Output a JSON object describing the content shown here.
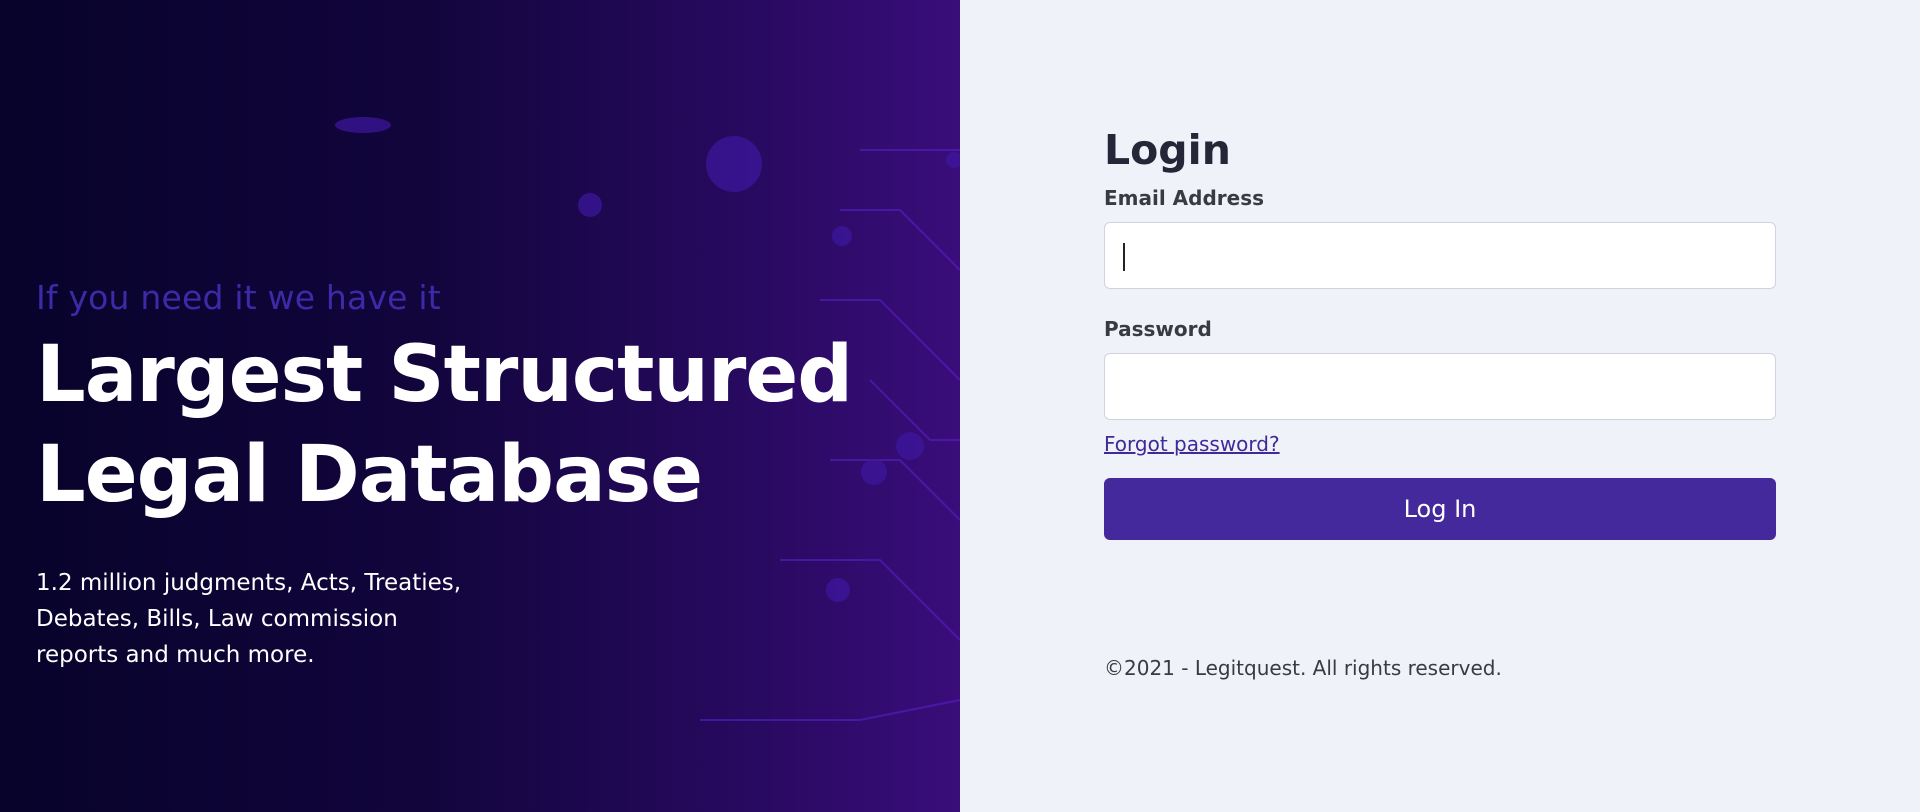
{
  "hero": {
    "tagline": "If you need it we have it",
    "headline_line1": "Largest Structured",
    "headline_line2": "Legal Database",
    "description": "1.2 million judgments, Acts, Treaties, Debates, Bills, Law commission reports and much more."
  },
  "login": {
    "title": "Login",
    "email_label": "Email Address",
    "email_value": "",
    "password_label": "Password",
    "password_value": "",
    "forgot_link": "Forgot password?",
    "submit_label": "Log In"
  },
  "footer": {
    "copyright": "©2021 - Legitquest. All rights reserved."
  },
  "colors": {
    "brand_purple": "#43299b",
    "hero_background": "#12053d",
    "tagline": "#3d2aa8",
    "panel_background": "#eff2f8"
  }
}
